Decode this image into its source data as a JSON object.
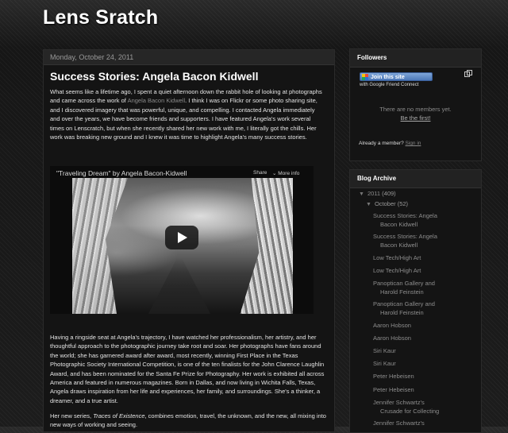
{
  "blog": {
    "title": "Lens Sratch"
  },
  "post": {
    "date": "Monday, October 24, 2011",
    "title": "Success Stories: Angela Bacon Kidwell",
    "intro_a": "What seems like a lifetime ago, I spent a quiet afternoon down the rabbit hole of looking at photographs and came across the work of ",
    "intro_link": "Angela Bacon Kidwell",
    "intro_b": ". I think I was on Flickr or some photo sharing site, and I discovered imagery that was powerful, unique, and compelling. I contacted Angela immediately and over the years, we have become friends and supporters. I have featured Angela's work several times on Lenscratch, but when she recently shared her new work with me, I literally got the chills. Her work was breaking new ground and I knew it was time to highlight Angela's many success stories.",
    "video": {
      "title": "\"Traveling Dream\" by Angela Bacon-Kidwell",
      "share": "Share",
      "more": "More info"
    },
    "para2": "Having a ringside seat at Angela's trajectory, I have watched her professionalism, her artistry, and her thoughtful approach to the photographic journey take root and soar. Her photographs have fans around the world; she has garnered award after award, most recently, winning First Place in the Texas Photographic Society International Competition, is one of the ten finalists for the John Clarence Laughlin Award, and has been nominated for the Santa Fe Prize for Photography. Her work is exhibited all across America and featured in numerous magazines. Born in Dallas, and now living in Wichita Falls, Texas, Angela draws inspiration from her life and experiences, her family, and surroundings. She's a thinker, a dreamer, and a true artist.",
    "para3_a": "Her new series, ",
    "para3_em": "Traces of Existence",
    "para3_b": ", combines emotion, travel, the unknown, and the new, all mixing into new ways of working and seeing."
  },
  "followers": {
    "heading": "Followers",
    "join_label": "Join this site",
    "gfc_sub": "with Google Friend Connect",
    "no_members": "There are no members yet.",
    "be_first": "Be the first!",
    "already": "Already a member? ",
    "sign_in": "Sign in"
  },
  "archive": {
    "heading": "Blog Archive",
    "year": "2011",
    "year_count": "(409)",
    "month": "October",
    "month_count": "(52)",
    "items": [
      [
        "Success Stories: Angela",
        "Bacon Kidwell"
      ],
      [
        "Success Stories: Angela",
        "Bacon Kidwell"
      ],
      [
        "Low Tech/High Art"
      ],
      [
        "Low Tech/High Art"
      ],
      [
        "Panoptican Gallery and",
        "Harold Feinstein"
      ],
      [
        "Panoptican Gallery and",
        "Harold Feinstein"
      ],
      [
        "Aaron Hobson"
      ],
      [
        "Aaron Hobson"
      ],
      [
        "Siri Kaur"
      ],
      [
        "Siri Kaur"
      ],
      [
        "Peter Hebeisen"
      ],
      [
        "Peter Hebeisen"
      ],
      [
        "Jennifer Schwartz's",
        "Crusade for Collecting"
      ],
      [
        "Jennifer Schwartz's"
      ]
    ]
  }
}
